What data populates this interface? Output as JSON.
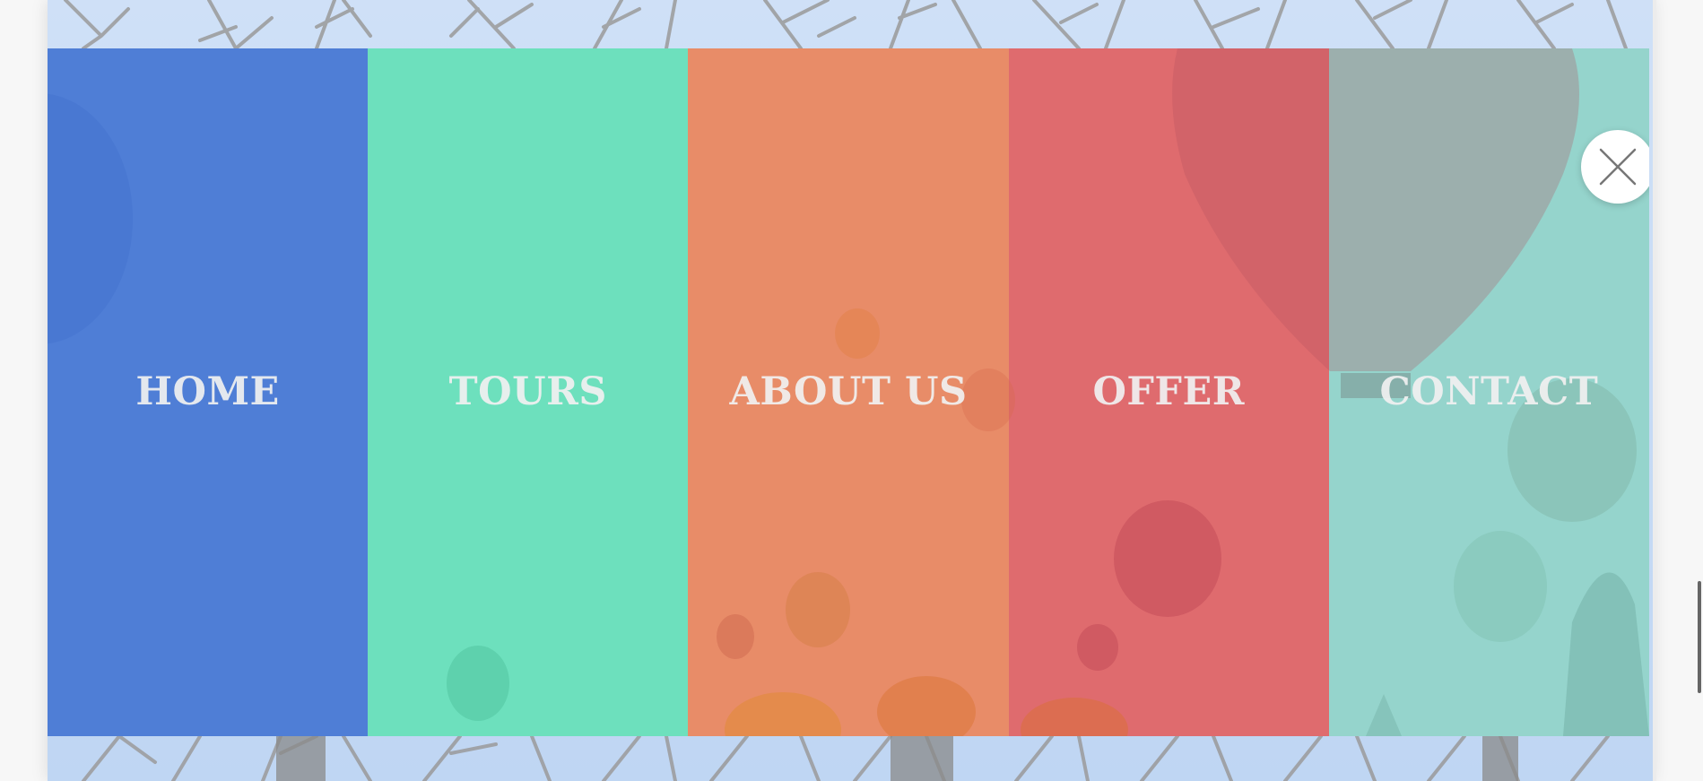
{
  "menu": {
    "items": [
      {
        "label": "HOME",
        "color": "#4f7ed6"
      },
      {
        "label": "TOURS",
        "color": "#6de0bd"
      },
      {
        "label": "ABOUT US",
        "color": "#e88c68"
      },
      {
        "label": "OFFER",
        "color": "#df6b6e"
      },
      {
        "label": "CONTACT",
        "color": "#95d4cc"
      }
    ],
    "close_icon": "close-icon"
  },
  "background": {
    "sky_color": "#c3d8f4",
    "branch_color": "#8f8f8f"
  }
}
